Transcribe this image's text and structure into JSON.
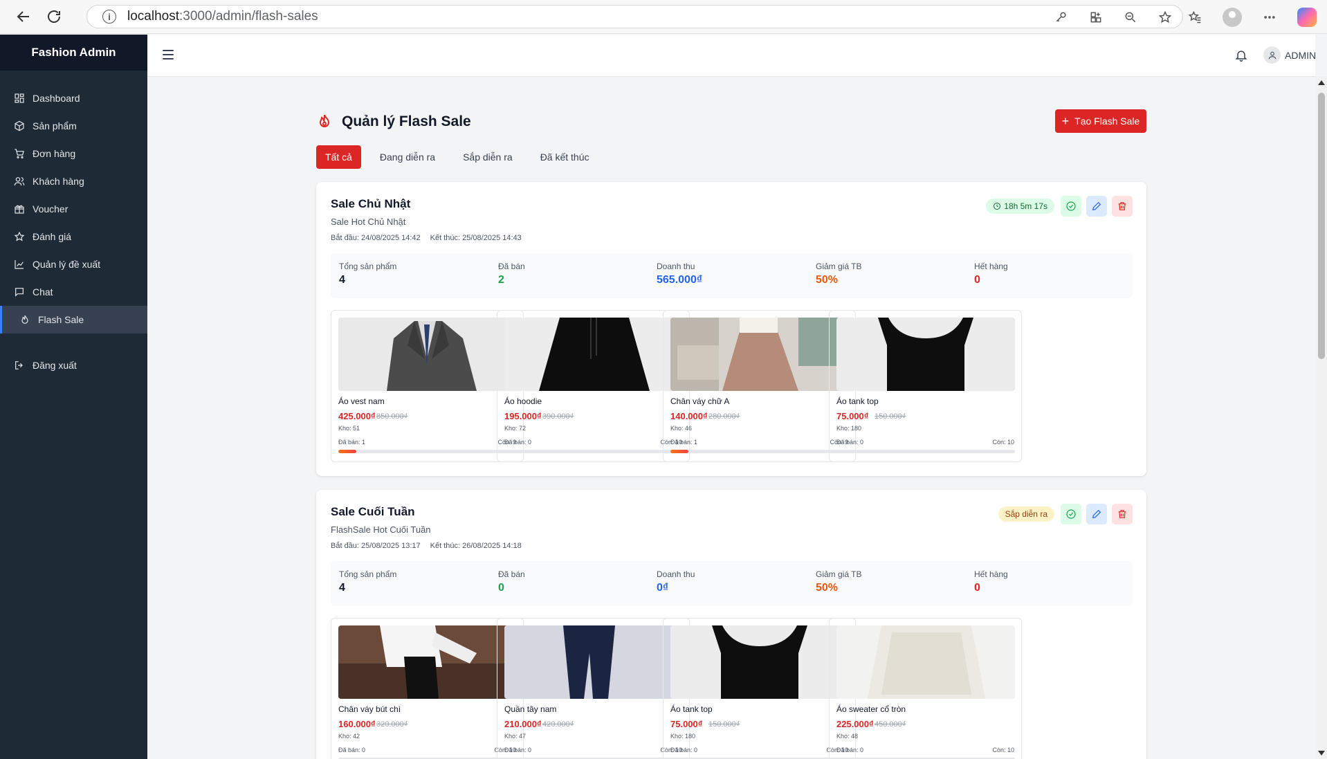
{
  "browser": {
    "url_host": "localhost",
    "url_path": ":3000/admin/flash-sales"
  },
  "sidebar": {
    "brand": "Fashion Admin",
    "items": [
      {
        "label": "Dashboard",
        "icon": "dashboard-icon"
      },
      {
        "label": "Sản phẩm",
        "icon": "box-icon"
      },
      {
        "label": "Đơn hàng",
        "icon": "cart-icon"
      },
      {
        "label": "Khách hàng",
        "icon": "users-icon"
      },
      {
        "label": "Voucher",
        "icon": "gift-icon"
      },
      {
        "label": "Đánh giá",
        "icon": "star-icon"
      },
      {
        "label": "Quản lý đề xuất",
        "icon": "chart-icon"
      },
      {
        "label": "Chat",
        "icon": "chat-icon"
      },
      {
        "label": "Flash Sale",
        "icon": "flame-icon",
        "active": true
      }
    ],
    "logout": "Đăng xuất"
  },
  "header": {
    "user_label": "ADMIN"
  },
  "page": {
    "title": "Quản lý Flash Sale",
    "create_button": "Tạo Flash Sale",
    "tabs": [
      "Tất cả",
      "Đang diễn ra",
      "Sắp diễn ra",
      "Đã kết thúc"
    ],
    "active_tab": "Tất cả"
  },
  "colors": {
    "accent": "#dc2626",
    "sidebar_bg": "#1f2a37",
    "sold_color": "#16a34a",
    "revenue_color": "#2563eb",
    "discount_color": "#ea580c",
    "out_of_stock_color": "#dc2626"
  },
  "sales": [
    {
      "title": "Sale Chủ Nhật",
      "subtitle": "Sale Hot Chủ Nhật",
      "start": "Bắt đầu: 24/08/2025 14:42",
      "end": "Kết thúc: 25/08/2025 14:43",
      "status": "18h 5m 17s",
      "status_type": "running",
      "stats": {
        "total_label": "Tổng sản phẩm",
        "total": "4",
        "sold_label": "Đã bán",
        "sold": "2",
        "revenue_label": "Doanh thu",
        "revenue": "565.000₫",
        "discount_label": "Giảm giá TB",
        "discount": "50%",
        "out_label": "Hết hàng",
        "out": "0"
      },
      "products": [
        {
          "name": "Áo vest nam",
          "price": "425.000₫",
          "original": "850.000₫",
          "stock": "Kho: 51",
          "sold": "Đã bán: 1",
          "left": "Còn: 9",
          "progress": 0.1,
          "image": "suit"
        },
        {
          "name": "Áo hoodie",
          "price": "195.000₫",
          "original": "390.000₫",
          "stock": "Kho: 72",
          "sold": "Đã bán: 0",
          "left": "Còn: 10",
          "progress": 0,
          "image": "hoodie"
        },
        {
          "name": "Chân váy chữ A",
          "price": "140.000₫",
          "original": "280.000₫",
          "stock": "Kho: 46",
          "sold": "Đã bán: 1",
          "left": "Còn: 9",
          "progress": 0.1,
          "image": "skirt-a"
        },
        {
          "name": "Áo tank top",
          "price": "75.000₫",
          "original": "150.000₫",
          "stock": "Kho: 180",
          "sold": "Đã bán: 0",
          "left": "Còn: 10",
          "progress": 0,
          "image": "tank"
        }
      ]
    },
    {
      "title": "Sale Cuối Tuần",
      "subtitle": "FlashSale Hot Cuối Tuần",
      "start": "Bắt đầu: 25/08/2025 13:17",
      "end": "Kết thúc: 26/08/2025 14:18",
      "status": "Sắp diễn ra",
      "status_type": "upcoming",
      "stats": {
        "total_label": "Tổng sản phẩm",
        "total": "4",
        "sold_label": "Đã bán",
        "sold": "0",
        "revenue_label": "Doanh thu",
        "revenue": "0₫",
        "discount_label": "Giảm giá TB",
        "discount": "50%",
        "out_label": "Hết hàng",
        "out": "0"
      },
      "products": [
        {
          "name": "Chân váy bút chì",
          "price": "160.000₫",
          "original": "320.000₫",
          "stock": "Kho: 42",
          "sold": "Đã bán: 0",
          "left": "Còn: 10",
          "progress": 0,
          "image": "pencil-skirt"
        },
        {
          "name": "Quần tây nam",
          "price": "210.000₫",
          "original": "420.000₫",
          "stock": "Kho: 47",
          "sold": "Đã bán: 0",
          "left": "Còn: 10",
          "progress": 0,
          "image": "trousers"
        },
        {
          "name": "Áo tank top",
          "price": "75.000₫",
          "original": "150.000₫",
          "stock": "Kho: 180",
          "sold": "Đã bán: 0",
          "left": "Còn: 10",
          "progress": 0,
          "image": "tank"
        },
        {
          "name": "Áo sweater cổ tròn",
          "price": "225.000₫",
          "original": "450.000₫",
          "stock": "Kho: 48",
          "sold": "Đã bán: 0",
          "left": "Còn: 10",
          "progress": 0,
          "image": "sweater"
        }
      ]
    }
  ]
}
